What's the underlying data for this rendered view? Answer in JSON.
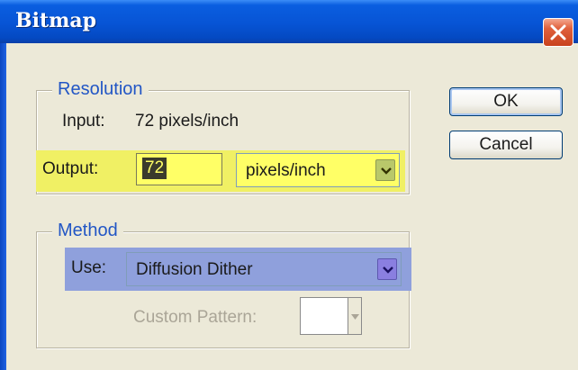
{
  "window": {
    "title": "Bitmap"
  },
  "resolution": {
    "group_label": "Resolution",
    "input_label": "Input:",
    "input_value": "72 pixels/inch",
    "output_label": "Output:",
    "output_value": "72",
    "output_unit": "pixels/inch",
    "highlight_color": "#f0f064"
  },
  "method": {
    "group_label": "Method",
    "use_label": "Use:",
    "use_value": "Diffusion Dither",
    "custom_pattern_label": "Custom Pattern:",
    "highlight_color": "#8fa0dc"
  },
  "buttons": {
    "ok": "OK",
    "cancel": "Cancel"
  },
  "icons": {
    "close": "close-icon",
    "dropdown": "chevron-down-icon"
  }
}
